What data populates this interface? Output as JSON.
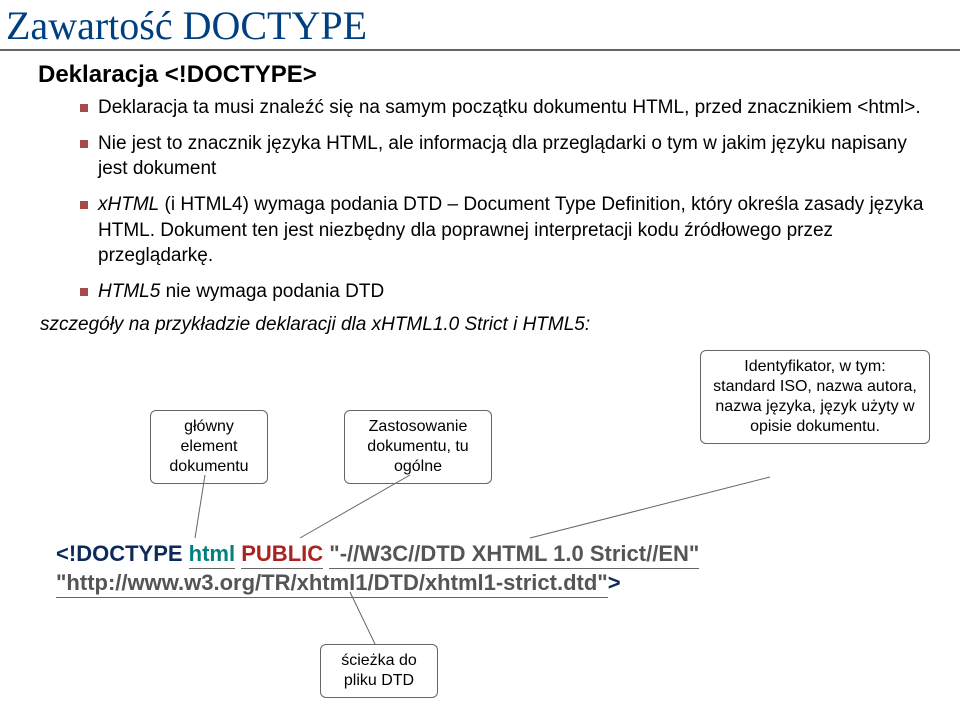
{
  "title": "Zawartość DOCTYPE",
  "heading": "Deklaracja <!DOCTYPE>",
  "bullets": {
    "b1": "Deklaracja ta musi znaleźć się na samym początku dokumentu HTML, przed znacznikiem <html>.",
    "b2": "Nie jest to znacznik języka HTML, ale informacją dla przeglądarki o tym w jakim języku napisany jest dokument",
    "b3_pre": "xHTML",
    "b3_rest": " (i HTML4) wymaga podania DTD – Document Type Definition, który określa zasady języka HTML. Dokument ten jest niezbędny dla poprawnej interpretacji kodu źródłowego przez przeglądarkę.",
    "b4_pre": "HTML5",
    "b4_rest": " nie wymaga podania DTD",
    "detail": "szczegóły na przykładzie deklaracji dla xHTML1.0 Strict i HTML5:"
  },
  "callouts": {
    "box1": "główny element dokumentu",
    "box2": "Zastosowanie dokumentu, tu ogólne",
    "box3": "Identyfikator, w tym: standard ISO, nazwa autora, nazwa języka, język użyty w opisie dokumentu.",
    "box4": "ścieżka do pliku DTD"
  },
  "code": {
    "lt": "<!",
    "doctype": "DOCTYPE",
    "sp": " ",
    "html": "html",
    "public": "PUBLIC",
    "fpi": "\"-//W3C//DTD XHTML 1.0 Strict//EN\"",
    "url": "\"http://www.w3.org/TR/xhtml1/DTD/xhtml1-strict.dtd\"",
    "gt": ">"
  }
}
